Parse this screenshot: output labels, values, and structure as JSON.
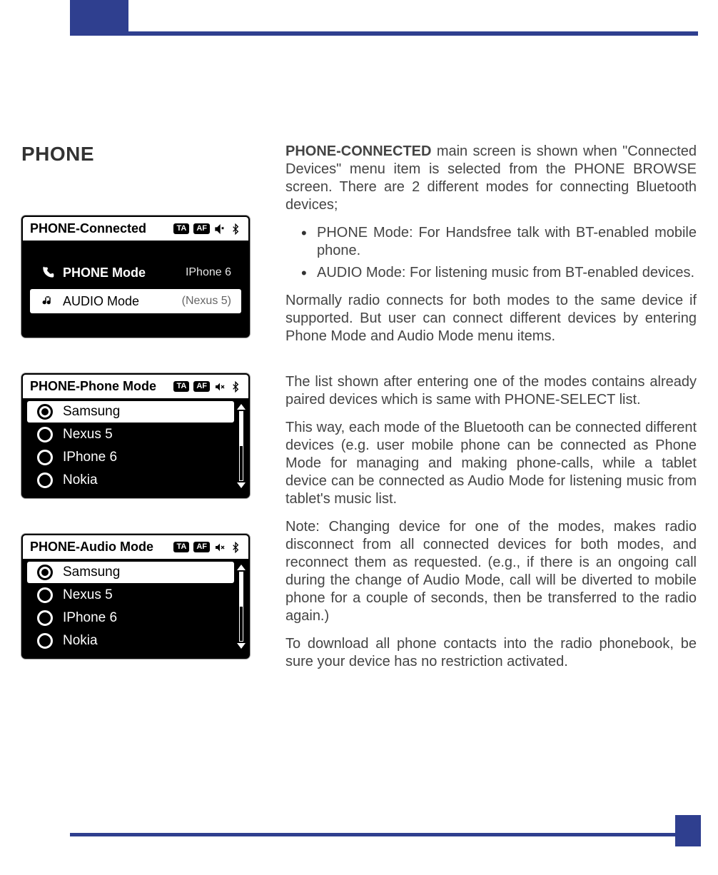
{
  "section_title": "PHONE",
  "screenshots": {
    "connected": {
      "title": "PHONE-Connected",
      "badges": [
        "TA",
        "AF"
      ],
      "phone_mode_label": "PHONE Mode",
      "phone_mode_device": "IPhone 6",
      "audio_mode_label": "AUDIO Mode",
      "audio_mode_device": "(Nexus 5)"
    },
    "phone_mode": {
      "title": "PHONE-Phone Mode",
      "badges": [
        "TA",
        "AF"
      ],
      "items": [
        "Samsung",
        "Nexus 5",
        "IPhone 6",
        "Nokia"
      ],
      "selected_index": 0
    },
    "audio_mode": {
      "title": "PHONE-Audio Mode",
      "badges": [
        "TA",
        "AF"
      ],
      "items": [
        "Samsung",
        "Nexus 5",
        "IPhone 6",
        "Nokia"
      ],
      "selected_index": 0
    }
  },
  "text": {
    "p1_bold": "PHONE-CONNECTED",
    "p1_rest": " main screen is shown when \"Connected Devices\" menu item is selected from the PHONE BROWSE screen. There are 2 different modes for connecting Bluetooth devices;",
    "b1": "PHONE Mode: For Handsfree talk with BT-enabled mobile phone.",
    "b2": "AUDIO Mode: For listening music from BT-enabled devices.",
    "p2": "Normally radio connects for both modes to the same device if supported. But user can connect different devices by entering Phone Mode and Audio Mode menu items.",
    "p3": "The list shown after entering one of the modes contains already paired devices which is same with PHONE-SELECT list.",
    "p4": "This way, each mode of the Bluetooth can be connected different devices (e.g. user mobile phone can be connected as Phone Mode for managing and making phone-calls, while a tablet device can be connected as Audio Mode for listening music from tablet's music list.",
    "p5": "Note: Changing device for one of the modes, makes radio disconnect from all connected devices for both modes, and reconnect them as requested. (e.g., if there is an ongoing call during the change of Audio Mode, call will be diverted to mobile phone for a couple of seconds, then be transferred to the radio again.)",
    "p6": "To download all phone contacts into the radio phonebook, be sure your device has no restriction activated."
  }
}
